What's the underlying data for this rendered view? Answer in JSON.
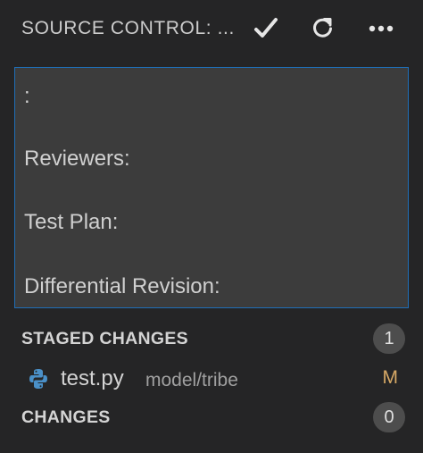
{
  "header": {
    "title": "SOURCE CONTROL: ...",
    "actions": [
      {
        "icon": "checkmark-icon",
        "label": "Commit"
      },
      {
        "icon": "refresh-icon",
        "label": "Refresh"
      },
      {
        "icon": "more-actions-icon",
        "label": "More Actions"
      }
    ]
  },
  "commit_message": {
    "lines": [
      ":",
      "Reviewers:",
      "Test Plan:",
      "Differential Revision:"
    ]
  },
  "staged": {
    "title": "STAGED CHANGES",
    "count": "1",
    "files": [
      {
        "name": "test.py",
        "dir": "model/tribe",
        "status": "M",
        "icon": "python-file-icon"
      }
    ]
  },
  "changes": {
    "title": "CHANGES",
    "count": "0"
  },
  "colors": {
    "background": "#252526",
    "input_background": "#3c3c3c",
    "focus_border": "#1f6fb8",
    "modified_status": "#d7a966",
    "badge": "#4d4d4d"
  }
}
